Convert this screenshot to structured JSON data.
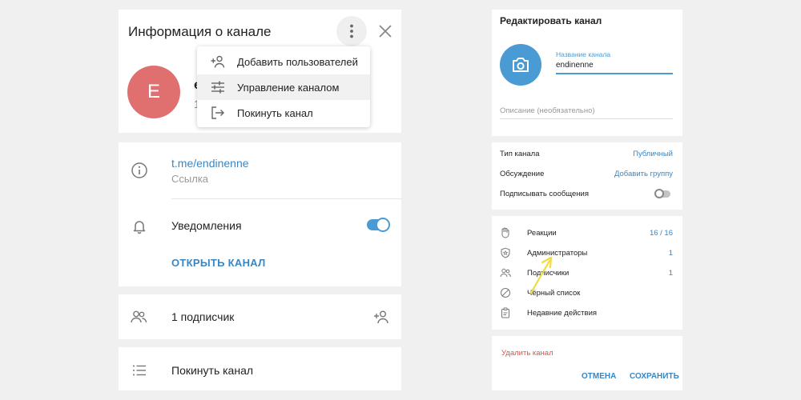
{
  "left_panel": {
    "title": "Информация о канале",
    "avatar_letter": "E",
    "channel_name_peek": "e",
    "subtitle_peek": "1",
    "link": "t.me/endinenne",
    "link_caption": "Ссылка",
    "notifications_label": "Уведомления",
    "notifications_on": true,
    "open_channel_label": "ОТКРЫТЬ КАНАЛ",
    "subscribers_label": "1 подписчик",
    "leave_label": "Покинуть канал"
  },
  "dropdown": {
    "items": [
      {
        "label": "Добавить пользователей",
        "icon": "add-user-icon"
      },
      {
        "label": "Управление каналом",
        "icon": "sliders-icon",
        "active": true
      },
      {
        "label": "Покинуть канал",
        "icon": "exit-icon"
      }
    ]
  },
  "right_panel": {
    "title": "Редактировать канал",
    "name_field_label": "Название канала",
    "name_field_value": "endinenne",
    "description_placeholder": "Описание (необязательно)",
    "settings": [
      {
        "label": "Тип канала",
        "value": "Публичный"
      },
      {
        "label": "Обсуждение",
        "value": "Добавить группу"
      },
      {
        "label": "Подписывать сообщения",
        "value": ""
      }
    ],
    "sign_messages_on": false,
    "manage": [
      {
        "label": "Реакции",
        "value": "16 / 16",
        "icon": "reactions-icon"
      },
      {
        "label": "Администраторы",
        "value": "1",
        "icon": "admin-shield-icon"
      },
      {
        "label": "Подписчики",
        "value": "1",
        "icon": "subscribers-icon"
      },
      {
        "label": "Чёрный список",
        "value": "",
        "icon": "blocked-icon"
      },
      {
        "label": "Недавние действия",
        "value": "",
        "icon": "clipboard-icon"
      }
    ],
    "delete_label": "Удалить канал",
    "cancel_label": "ОТМЕНА",
    "save_label": "СОХРАНИТЬ"
  },
  "colors": {
    "accent": "#4a9bd4",
    "link": "#3a86c2",
    "avatar": "#e07070",
    "danger": "#d9534f",
    "annotation_arrow": "#f2dc3c"
  }
}
